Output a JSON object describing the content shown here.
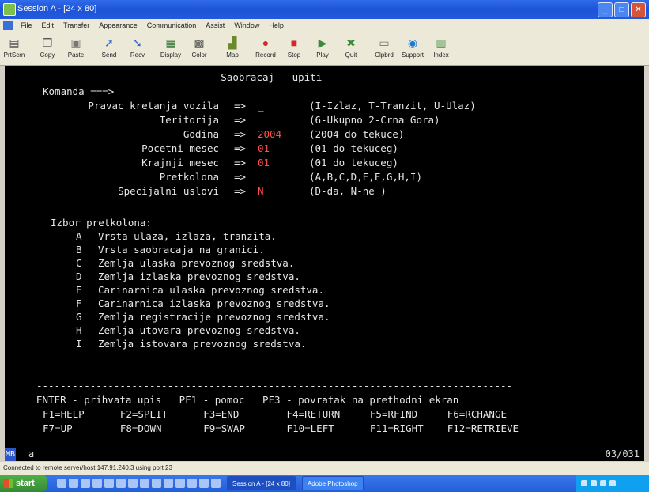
{
  "window": {
    "title": "Session A - [24 x 80]"
  },
  "menu": [
    "File",
    "Edit",
    "Transfer",
    "Appearance",
    "Communication",
    "Assist",
    "Window",
    "Help"
  ],
  "toolbar": [
    {
      "label": "PrtScrn",
      "icon": "printer-icon",
      "glyph": "▤"
    },
    {
      "label": "Copy",
      "icon": "copy-icon",
      "glyph": "❐"
    },
    {
      "label": "Paste",
      "icon": "paste-icon",
      "glyph": "▣"
    },
    {
      "label": "Send",
      "icon": "send-icon",
      "glyph": "➚"
    },
    {
      "label": "Recv",
      "icon": "receive-icon",
      "glyph": "➘"
    },
    {
      "label": "Display",
      "icon": "display-icon",
      "glyph": "▦"
    },
    {
      "label": "Color",
      "icon": "color-icon",
      "glyph": "▩"
    },
    {
      "label": "Map",
      "icon": "map-icon",
      "glyph": "▟"
    },
    {
      "label": "Record",
      "icon": "record-icon",
      "glyph": "●"
    },
    {
      "label": "Stop",
      "icon": "stop-icon",
      "glyph": "■"
    },
    {
      "label": "Play",
      "icon": "play-icon",
      "glyph": "▶"
    },
    {
      "label": "Quit",
      "icon": "quit-icon",
      "glyph": "✖"
    },
    {
      "label": "Clpbrd",
      "icon": "clipboard-icon",
      "glyph": "▭"
    },
    {
      "label": "Support",
      "icon": "globe-icon",
      "glyph": "◉"
    },
    {
      "label": "Index",
      "icon": "index-icon",
      "glyph": "▥"
    }
  ],
  "screen": {
    "header": "------------------------------ Saobracaj - upiti ------------------------------",
    "komanda": "Komanda ===>",
    "fields": [
      {
        "label": "Pravac kretanja vozila",
        "arrow": "=>",
        "value": "_",
        "hint": "(I-Izlaz, T-Tranzit, U-Ulaz)"
      },
      {
        "label": "Teritorija",
        "arrow": "=>",
        "value": "",
        "hint": "(6-Ukupno 2-Crna Gora)"
      },
      {
        "label": "Godina",
        "arrow": "=>",
        "value": "2004",
        "hint": "(2004 do tekuce)"
      },
      {
        "label": "Pocetni mesec",
        "arrow": "=>",
        "value": "01",
        "hint": "(01 do tekuceg)"
      },
      {
        "label": "Krajnji mesec",
        "arrow": "=>",
        "value": "01",
        "hint": "(01 do tekuceg)"
      },
      {
        "label": "Pretkolona",
        "arrow": "=>",
        "value": "",
        "hint": "(A,B,C,D,E,F,G,H,I)"
      },
      {
        "label": "Specijalni uslovi",
        "arrow": "=>",
        "value": "N",
        "hint": "(D-da, N-ne )"
      }
    ],
    "separator": "------------------------------------------------------------------------",
    "izbor_title": "Izbor pretkolona:",
    "izbor": [
      {
        "k": "A",
        "t": "Vrsta ulaza, izlaza, tranzita."
      },
      {
        "k": "B",
        "t": "Vrsta saobracaja na granici."
      },
      {
        "k": "C",
        "t": "Zemlja ulaska prevoznog sredstva."
      },
      {
        "k": "D",
        "t": "Zemlja izlaska prevoznog sredstva."
      },
      {
        "k": "E",
        "t": "Carinarnica ulaska prevoznog sredstva."
      },
      {
        "k": "F",
        "t": "Carinarnica izlaska prevoznog sredstva."
      },
      {
        "k": "G",
        "t": "Zemlja registracije prevoznog sredstva."
      },
      {
        "k": "H",
        "t": "Zemlja utovara prevoznog sredstva."
      },
      {
        "k": "I",
        "t": "Zemlja istovara prevoznog sredstva."
      }
    ],
    "bottom_sep": "--------------------------------------------------------------------------------",
    "enter_line": "ENTER - prihvata upis   PF1 - pomoc   PF3 - povratak na prethodni ekran",
    "pf_row1": "F1=HELP      F2=SPLIT      F3=END        F4=RETURN     F5=RFIND     F6=RCHANGE",
    "pf_row2": "F7=UP        F8=DOWN       F9=SWAP       F10=LEFT      F11=RIGHT    F12=RETRIEVE"
  },
  "status": {
    "mb": "MB",
    "mode": "a",
    "pos": "03/031"
  },
  "connection": "Connected to remote server/host 147.91.240.3 using port 23",
  "taskbar": {
    "start": "start",
    "tasks": [
      "Session A - [24 x 80]",
      "Adobe Photoshop"
    ]
  },
  "colors": {
    "terminal_bg": "#000000",
    "input_value": "#ff5050",
    "titlebar": "#245edb"
  }
}
